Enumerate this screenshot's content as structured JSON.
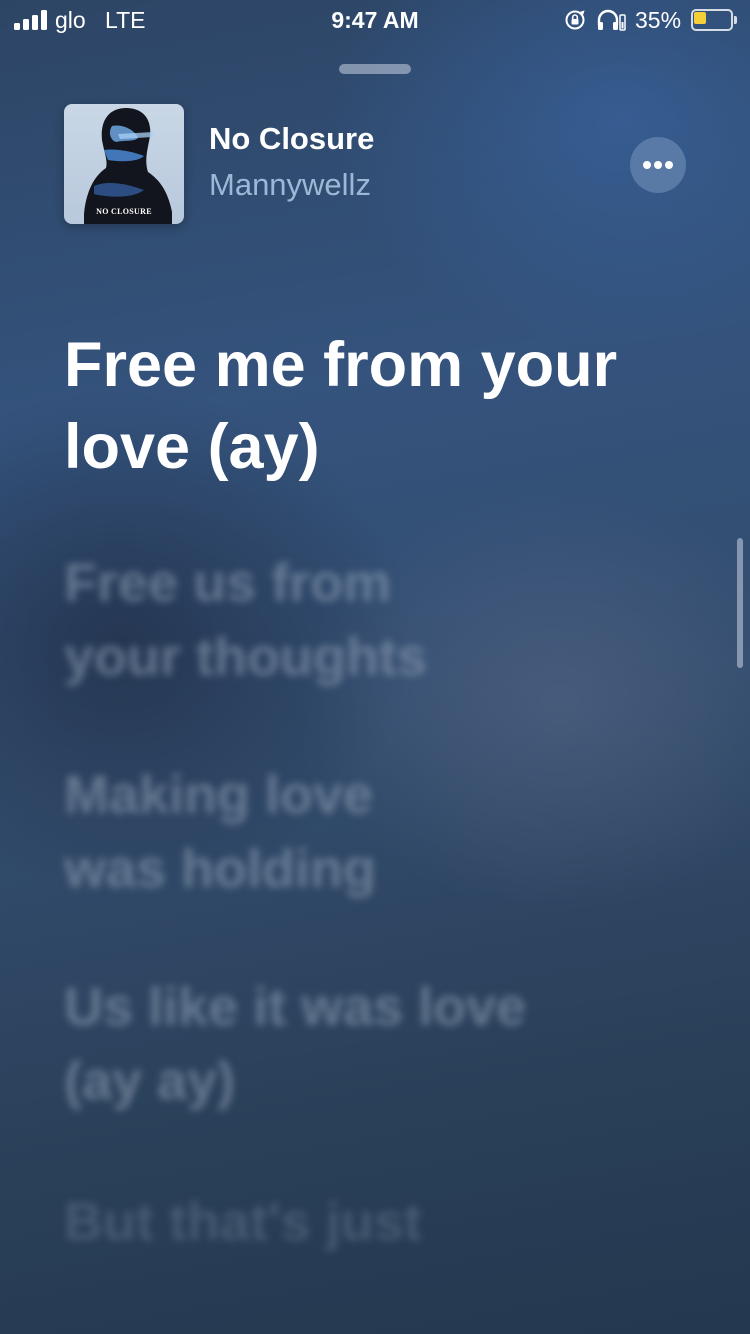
{
  "status_bar": {
    "carrier": "glo",
    "network": "LTE",
    "time": "9:47 AM",
    "battery_percent_label": "35%",
    "battery_level": 0.35,
    "battery_fill_color": "#f5cf3a",
    "icons": [
      "signal-icon",
      "orientation-lock-icon",
      "headphones-icon",
      "battery-icon"
    ]
  },
  "now_playing": {
    "album_art_caption": "NO CLOSURE",
    "title": "No Closure",
    "artist": "Mannywellz",
    "more_button_icon": "ellipsis-icon"
  },
  "lyrics": {
    "current": [
      "Free me from your",
      "love (ay)"
    ],
    "upcoming": [
      [
        "Free us from",
        "your thoughts"
      ],
      [
        "Making love",
        "was holding"
      ],
      [
        "Us like it was love",
        "(ay ay)"
      ],
      [
        "But that's just",
        ""
      ]
    ]
  },
  "colors": {
    "background_top": "#2d4565",
    "background_bottom": "#24384f",
    "accent_artist": "#aac3e1",
    "battery_fill": "#f5cf3a"
  }
}
